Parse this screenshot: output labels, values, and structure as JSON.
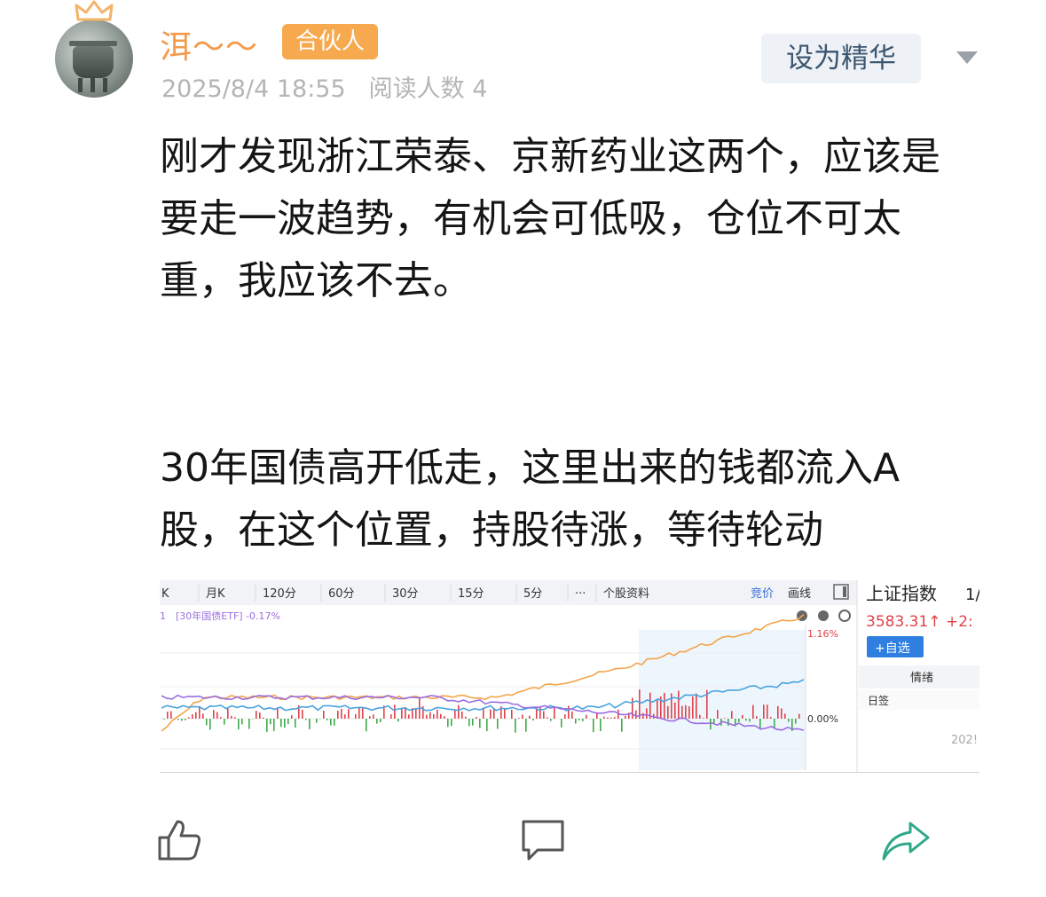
{
  "post": {
    "username": "洱～～",
    "badge": "合伙人",
    "timestamp": "2025/8/4 18:55",
    "read_count_label": "阅读人数 4",
    "set_featured_label": "设为精华",
    "paragraph_1": "刚才发现浙江荣泰、京新药业这两个，应该是要走一波趋势，有机会可低吸，仓位不可太重，我应该不去。",
    "paragraph_2": "30年国债高开低走，这里出来的钱都流入A股，在这个位置，持股待涨，等待轮动"
  },
  "chart_screenshot": {
    "tabs": [
      "K",
      "月K",
      "120分",
      "60分",
      "30分",
      "15分",
      "5分",
      "···",
      "个股资料"
    ],
    "right_tabs": [
      "竞价",
      "画线"
    ],
    "legend": "[30年国债ETF] -0.17%",
    "legend_prefix": "1",
    "pct_top": "1.16%",
    "pct_zero": "0.00%",
    "index_name": "上证指数",
    "index_name_suffix": "1/",
    "index_value": "3583.31↑ +2:",
    "add_watch_label": "+自选",
    "mood_label": "情绪",
    "sign_label": "日签",
    "year_label": "202!",
    "colors": {
      "orange": "#f3a44a",
      "blue": "#4aa3df",
      "purple": "#9b6de0",
      "red": "#e0424a",
      "green": "#3ea94a"
    }
  },
  "actions": {
    "like": "thumbs-up-icon",
    "comment": "comment-icon",
    "share": "share-icon"
  },
  "colors": {
    "username": "#f39a4b",
    "badge_bg": "#f6a94e",
    "share_icon": "#2fa88a",
    "meta": "#b5b5b5"
  }
}
